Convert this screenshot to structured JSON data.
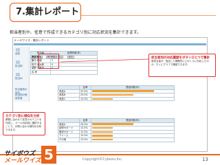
{
  "slide": {
    "title": "7.集計レポート",
    "subtitle": "担当者別や、任意で作成できるカテゴリ別に対応状況を集計できます。",
    "copyright": "Copyright©Cybozu,Inc.",
    "page_number": "13"
  },
  "logo": {
    "line1": "サイボウズ",
    "line2": "メールワイズ",
    "number": "5"
  },
  "app": {
    "window_title": "メールワイズ - 集計レポート",
    "nav": [
      "全般",
      "担当別",
      "担当ID",
      "担当者別の対応",
      "担当別の受信件数"
    ],
    "agg_label": "集計条件",
    "period_label": "期間(過去7日)",
    "display_label": "表示",
    "table1": {
      "headers": [
        "担当者",
        "処理件数(件)"
      ],
      "rows": [
        {
          "name": "田嶋 謙也",
          "value": "7"
        },
        {
          "name": "鶴中 和雄",
          "value": "7"
        },
        {
          "name": "松中 津太郎",
          "value": "0"
        },
        {
          "name": "堀野 久美子",
          "value": "0"
        },
        {
          "name": "合 考",
          "value": ""
        }
      ]
    },
    "table2": {
      "headers": [
        "",
        "比率",
        "受信件数(件)"
      ],
      "rows": [
        {
          "name": "商品A",
          "ratio": "37.5%",
          "bar": 0.375
        },
        {
          "name": "商品B",
          "ratio": "25.0%",
          "bar": 0.25
        },
        {
          "name": "商品C",
          "ratio": "12.5%",
          "bar": 0.125
        }
      ]
    },
    "table3": {
      "headers": [
        "",
        "比率",
        "受信件数(件)"
      ],
      "rows": [
        {
          "name": "商品A",
          "ratio": "25.0%",
          "bar": 0.25
        },
        {
          "name": "技術サポート",
          "ratio": "12.5%",
          "bar": 0.125
        },
        {
          "name": "販売サポート",
          "ratio": "12.5%",
          "bar": 0.125
        },
        {
          "name": "クレーム",
          "ratio": "12.5%",
          "bar": 0.125
        },
        {
          "name": "その他",
          "ratio": "12.5%",
          "bar": 0.125
        }
      ]
    }
  },
  "callouts": {
    "top": {
      "heading": "担当者別の対応履歴をボタンひとつで集計",
      "body": "各担当者が、指定した期間内にどのくらい対応したのか、すぐにグラフで確認できます。"
    },
    "left": {
      "heading": "カテゴリ別に傾向を分析",
      "body": "業務に合わせて任意のカテゴリを作成し、メール対応時に選択することで、お問い合わせ傾向を分析できます。"
    }
  },
  "colors": {
    "accent": "#e8641a",
    "callout": "#e03030",
    "bar": "#f0a030"
  }
}
